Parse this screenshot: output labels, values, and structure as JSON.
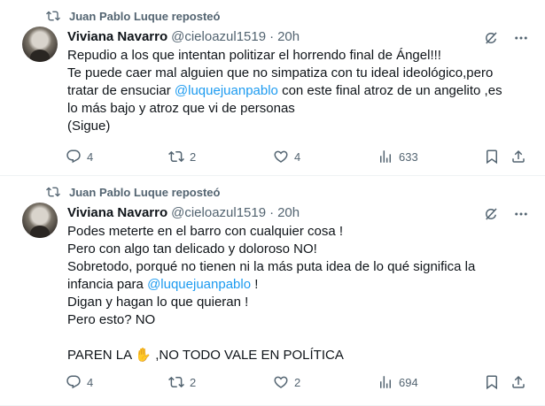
{
  "tweets": [
    {
      "repost_label": "Juan Pablo Luque reposteó",
      "author_name": "Viviana Navarro",
      "handle": "@cieloazul1519",
      "separator": "·",
      "time": "20h",
      "lines": [
        {
          "parts": [
            {
              "text": "Repudio a los que intentan politizar el horrendo final de Ángel!!!",
              "mention": false
            }
          ]
        },
        {
          "parts": [
            {
              "text": "Te puede caer mal alguien que no simpatiza con tu ideal ideológico,pero",
              "mention": false
            }
          ]
        },
        {
          "parts": [
            {
              "text": "tratar de ensuciar ",
              "mention": false
            },
            {
              "text": "@luquejuanpablo",
              "mention": true
            },
            {
              "text": " con este final atroz de un angelito ,es",
              "mention": false
            }
          ]
        },
        {
          "parts": [
            {
              "text": "lo más bajo y atroz que vi de personas",
              "mention": false
            }
          ]
        },
        {
          "parts": [
            {
              "text": "(Sigue)",
              "mention": false
            }
          ]
        }
      ],
      "replies": "4",
      "reposts": "2",
      "likes": "4",
      "views": "633"
    },
    {
      "repost_label": "Juan Pablo Luque reposteó",
      "author_name": "Viviana Navarro",
      "handle": "@cieloazul1519",
      "separator": "·",
      "time": "20h",
      "lines": [
        {
          "parts": [
            {
              "text": "Podes meterte en el barro con cualquier cosa !",
              "mention": false
            }
          ]
        },
        {
          "parts": [
            {
              "text": "Pero con algo tan delicado y doloroso NO!",
              "mention": false
            }
          ]
        },
        {
          "parts": [
            {
              "text": "Sobretodo, porqué no tienen ni la más puta idea de lo qué significa la",
              "mention": false
            }
          ]
        },
        {
          "parts": [
            {
              "text": "infancia para ",
              "mention": false
            },
            {
              "text": "@luquejuanpablo",
              "mention": true
            },
            {
              "text": " !",
              "mention": false
            }
          ]
        },
        {
          "parts": [
            {
              "text": "Digan y hagan lo que quieran !",
              "mention": false
            }
          ]
        },
        {
          "parts": [
            {
              "text": "Pero esto? NO",
              "mention": false
            }
          ]
        },
        {
          "parts": []
        },
        {
          "parts": [
            {
              "text": "PAREN LA ✋ ,NO TODO VALE EN POLÍTICA",
              "mention": false
            }
          ]
        }
      ],
      "replies": "4",
      "reposts": "2",
      "likes": "2",
      "views": "694"
    }
  ],
  "icons": {
    "repost": "repost-icon",
    "grok": "grok-icon",
    "more": "more-icon",
    "reply": "reply-icon",
    "like": "heart-icon",
    "views": "views-icon",
    "bookmark": "bookmark-icon",
    "share": "share-icon"
  },
  "colors": {
    "text": "#0f1419",
    "muted": "#536471",
    "mention": "#1d9bf0",
    "divider": "#eff3f4"
  }
}
